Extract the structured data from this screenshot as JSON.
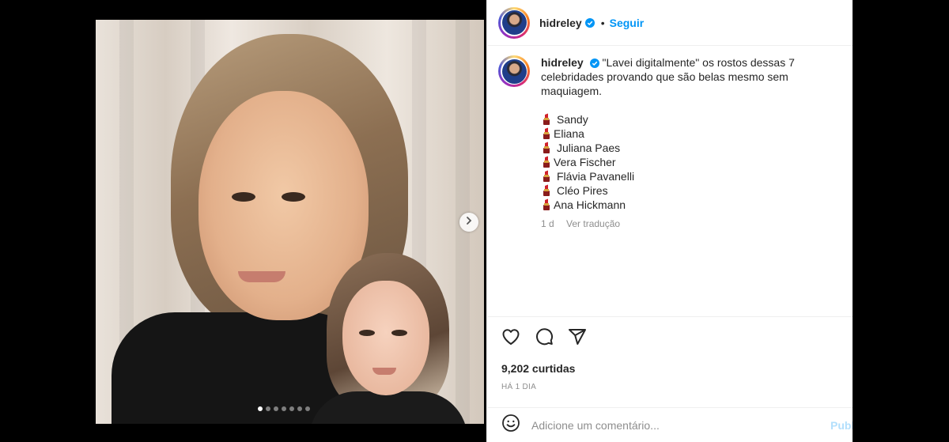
{
  "post": {
    "username": "hidreley",
    "follow_label": "Seguir",
    "separator": "•",
    "caption_text": "\"Lavei digitalmente\" os rostos dessas 7 celebridades provando que são belas mesmo sem maquiagem.",
    "celebrities": [
      {
        "name": "Sandy",
        "spaced": true
      },
      {
        "name": "Eliana",
        "spaced": false
      },
      {
        "name": "Juliana Paes",
        "spaced": true
      },
      {
        "name": "Vera Fischer",
        "spaced": false
      },
      {
        "name": "Flávia Pavanelli",
        "spaced": true
      },
      {
        "name": "Cléo Pires",
        "spaced": true
      },
      {
        "name": "Ana Hickmann",
        "spaced": false
      }
    ],
    "caption_age": "1 d",
    "translate_label": "Ver tradução",
    "likes": "9,202 curtidas",
    "posted_time": "HÁ 1 DIA",
    "comment_placeholder": "Adicione um comentário...",
    "publish_label": "Publicar"
  },
  "carousel": {
    "slide_count": 7,
    "active_index": 0
  },
  "colors": {
    "link": "#0095f6",
    "verified": "#0095f6",
    "muted": "#8e8e8e",
    "publish_disabled": "#b2dffc"
  },
  "icons": {
    "like": "heart-icon",
    "comment": "comment-icon",
    "share": "send-icon",
    "emoji": "emoji-icon",
    "next": "chevron-right-icon",
    "verified": "verified-badge-icon",
    "lipstick": "lipstick-emoji-icon"
  }
}
